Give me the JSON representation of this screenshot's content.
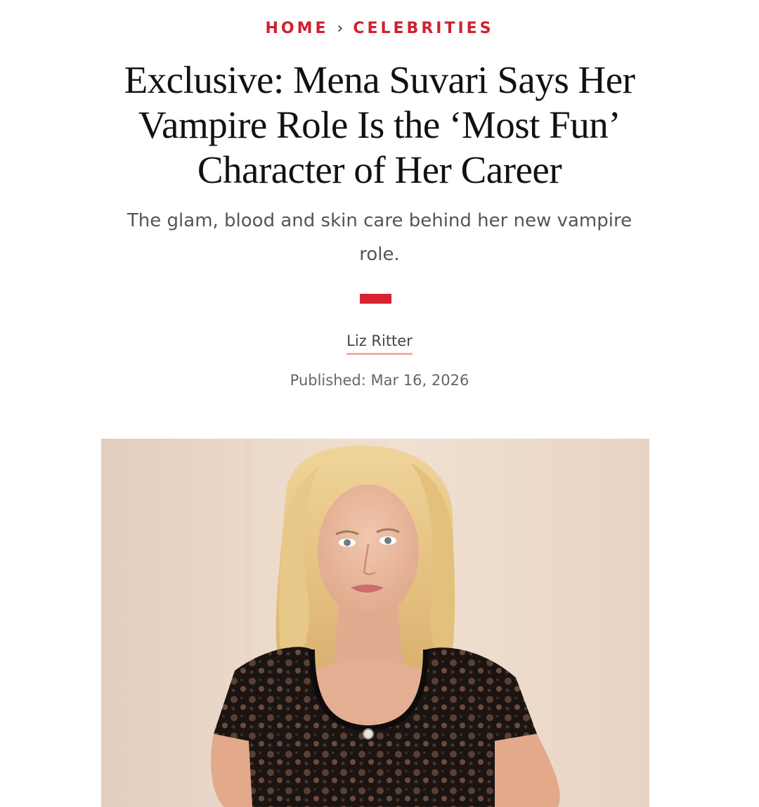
{
  "breadcrumb": {
    "home": "HOME",
    "separator": "›",
    "section": "CELEBRITIES"
  },
  "article": {
    "headline": "Exclusive: Mena Suvari Says Her Vampire Role Is the ‘Most Fun’ Character of Her Career",
    "dek": "The glam, blood and skin care behind her new vampire role.",
    "author": "Liz Ritter",
    "published": "Published: Mar 16, 2026"
  },
  "colors": {
    "accent": "#d0202f",
    "author_underline": "#f2b09a",
    "text": "#111111",
    "muted": "#555555"
  },
  "hero_image": {
    "subject": "portrait-photo"
  }
}
